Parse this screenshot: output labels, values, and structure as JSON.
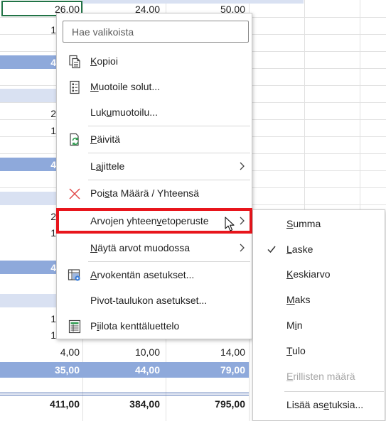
{
  "sheet": {
    "visible_rows": [
      {
        "c1": "26,00",
        "c2": "24,00",
        "c3": "50,00"
      },
      {
        "c1": "1",
        "c2": "",
        "c3": ""
      },
      {
        "c1": "4",
        "c2": "",
        "c3": ""
      },
      {
        "c1": "2",
        "c2": "",
        "c3": ""
      },
      {
        "c1": "1",
        "c2": "",
        "c3": ""
      },
      {
        "c1": "4",
        "c2": "",
        "c3": ""
      },
      {
        "c1": "2",
        "c2": "",
        "c3": ""
      },
      {
        "c1": "1",
        "c2": "",
        "c3": ""
      },
      {
        "c1": "4",
        "c2": "",
        "c3": ""
      },
      {
        "c1": "1",
        "c2": "",
        "c3": ""
      },
      {
        "c1": "1",
        "c2": "",
        "c3": ""
      }
    ],
    "row_4_10_14": {
      "c1": "4,00",
      "c2": "10,00",
      "c3": "14,00"
    },
    "subtotal_row": {
      "c1": "35,00",
      "c2": "44,00",
      "c3": "79,00"
    },
    "grand_total_row": {
      "c1": "411,00",
      "c2": "384,00",
      "c3": "795,00"
    }
  },
  "context_menu": {
    "search_placeholder": "Hae valikoista",
    "items": {
      "copy": {
        "pre": "",
        "acc": "K",
        "post": "opioi"
      },
      "format_cells": {
        "pre": "",
        "acc": "M",
        "post": "uotoile solut..."
      },
      "number_format": {
        "pre": "Luk",
        "acc": "u",
        "post": "muotoilu..."
      },
      "refresh": {
        "pre": "",
        "acc": "P",
        "post": "äivitä"
      },
      "sort": {
        "pre": "L",
        "acc": "a",
        "post": "jittele"
      },
      "remove": {
        "pre": "Poi",
        "acc": "s",
        "post": "ta Määrä  / Yhteensä"
      },
      "summarize_by": {
        "pre": "Arvojen yhteen",
        "acc": "v",
        "post": "etoperuste"
      },
      "show_values_as": {
        "pre": "",
        "acc": "N",
        "post": "äytä arvot muodossa"
      },
      "value_field_settings": {
        "pre": "",
        "acc": "A",
        "post": "rvokentän asetukset..."
      },
      "pivot_options": {
        "pre": "Pivot-taulukon asetukset",
        "acc": "",
        "post": "..."
      },
      "hide_field_list": {
        "pre": "P",
        "acc": "i",
        "post": "ilota kenttäluettelo"
      }
    }
  },
  "submenu": {
    "items": {
      "sum": {
        "pre": "",
        "acc": "S",
        "post": "umma"
      },
      "count": {
        "pre": "",
        "acc": "L",
        "post": "aske"
      },
      "average": {
        "pre": "",
        "acc": "K",
        "post": "eskiarvo"
      },
      "max": {
        "pre": "",
        "acc": "M",
        "post": "aks"
      },
      "min": {
        "pre": "M",
        "acc": "i",
        "post": "n"
      },
      "product": {
        "pre": "",
        "acc": "T",
        "post": "ulo"
      },
      "distinct_count": {
        "pre": "",
        "acc": "E",
        "post": "rillisten määrä"
      },
      "more_options": {
        "pre": "Lisää as",
        "acc": "e",
        "post": "tuksia..."
      }
    },
    "checked_item": "count"
  },
  "colors": {
    "band_blue": "#8ea9db",
    "band_light": "#d9e1f2",
    "highlight_border": "#e8151c",
    "active_cell_border": "#217346"
  }
}
